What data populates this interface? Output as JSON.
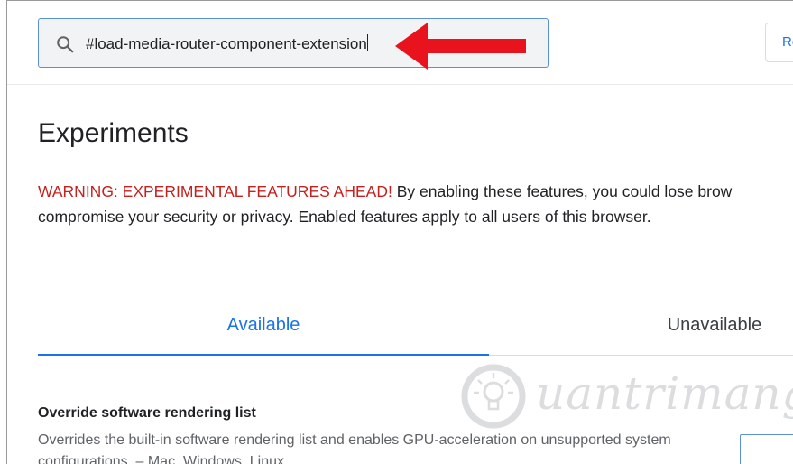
{
  "search": {
    "value": "#load-media-router-component-extension"
  },
  "header": {
    "reset_label": "Re"
  },
  "main": {
    "title": "Experiments",
    "warning_prefix": "WARNING: EXPERIMENTAL FEATURES AHEAD!",
    "warning_body": " By enabling these features, you could lose brow",
    "warning_line2": "compromise your security or privacy. Enabled features apply to all users of this browser.",
    "tabs": [
      {
        "label": "Available"
      },
      {
        "label": "Unavailable"
      }
    ],
    "feature": {
      "title": "Override software rendering list",
      "description": "Overrides the built-in software rendering list and enables GPU-acceleration on unsupported system configurations. – Mac, Windows, Linux"
    }
  },
  "watermark": {
    "text": "uantrimang"
  },
  "colors": {
    "accent": "#1a73e8",
    "warning": "#c5221f",
    "arrow": "#e8131c"
  }
}
